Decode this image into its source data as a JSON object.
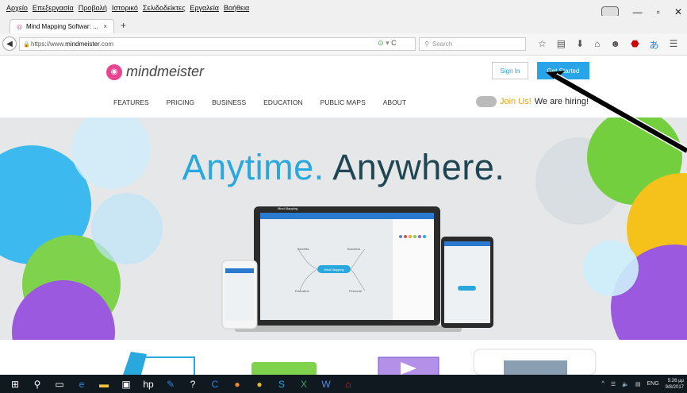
{
  "menu": [
    "Αρχείο",
    "Επεξεργασία",
    "Προβολή",
    "Ιστορικό",
    "Σελιδοδείκτες",
    "Εργαλεία",
    "Βοήθεια"
  ],
  "tab": {
    "title": "Mind Mapping Softwar: ...",
    "close": "×"
  },
  "address": {
    "prefix": "https://www.",
    "domain": "mindmeister",
    "suffix": ".com",
    "search_placeholder": "Search"
  },
  "site": {
    "logo": "mindmeister",
    "signin": "Sign In",
    "get_started": "Get Started",
    "nav": [
      "FEATURES",
      "PRICING",
      "BUSINESS",
      "EDUCATION",
      "PUBLIC MAPS",
      "ABOUT"
    ],
    "join": "Join Us!",
    "join_rest": "We are hiring!"
  },
  "hero": {
    "word1": "Anytime.",
    "word2": "Anywhere.",
    "accent": "#29a8de",
    "dark": "#1f4652"
  },
  "mockup": {
    "app_title": "Mind Mapping",
    "center": "Mind Mapping",
    "branches": [
      "Benefits",
      "Business",
      "Education",
      "Personal"
    ]
  },
  "tray": {
    "lang": "ENG",
    "time": "5:26 μμ",
    "date": "9/8/2017"
  },
  "icons": [
    "windows-icon",
    "search-icon",
    "task-view-icon",
    "edge-icon",
    "explorer-icon",
    "store-icon",
    "hp-icon",
    "pencil-icon",
    "help-icon",
    "chrome-like-icon",
    "firefox-icon",
    "chrome-icon",
    "skype-icon",
    "excel-icon",
    "word-icon",
    "acrobat-icon"
  ]
}
